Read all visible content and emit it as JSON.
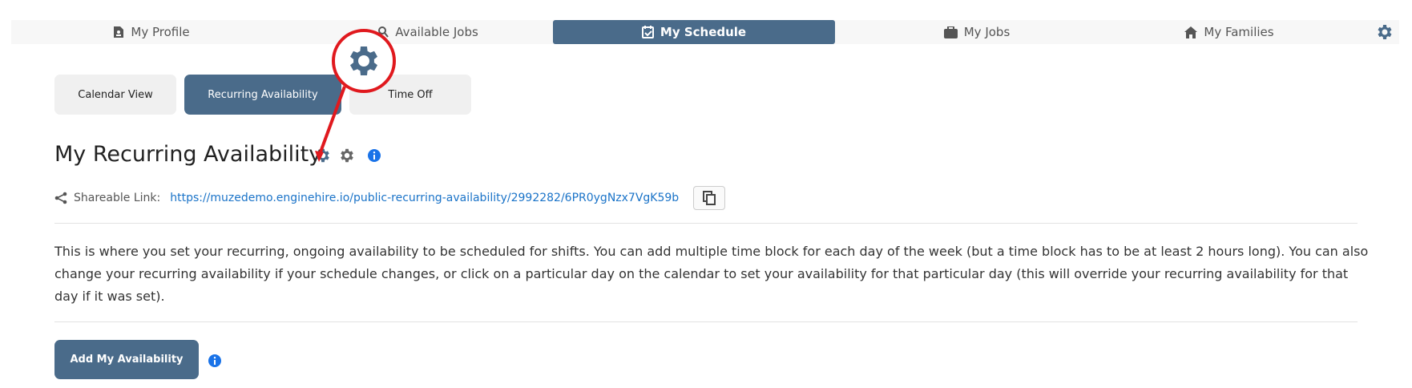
{
  "nav": {
    "items": [
      {
        "label": "My Profile",
        "icon": "profile-icon"
      },
      {
        "label": "Available Jobs",
        "icon": "jobs-search-icon"
      },
      {
        "label": "My Schedule",
        "icon": "calendar-check-icon"
      },
      {
        "label": "My Jobs",
        "icon": "briefcase-icon"
      },
      {
        "label": "My Families",
        "icon": "home-icon"
      }
    ],
    "active": "My Schedule",
    "settings_icon": "gear-icon"
  },
  "subtabs": {
    "items": [
      "Calendar View",
      "Recurring Availability",
      "Time Off"
    ],
    "active": "Recurring Availability"
  },
  "page": {
    "title": "My Recurring Availability",
    "share_label": "Shareable Link:",
    "share_url": "https://muzedemo.enginehire.io/public-recurring-availability/2992282/6PR0ygNzx7VgK59b",
    "description": "This is where you set your recurring, ongoing availability to be scheduled for shifts. You can add multiple time block for each day of the week (but a time block has to be at least 2 hours long). You can also change your recurring availability if your schedule changes, or click on a particular day on the calendar to set your availability for that particular day (this will override your recurring availability for that day if it was set).",
    "add_button": "Add My Availability"
  },
  "colors": {
    "accent": "#4a6b8a",
    "link": "#1a73c8",
    "info": "#1a73e8",
    "annotation": "#e0191e"
  }
}
